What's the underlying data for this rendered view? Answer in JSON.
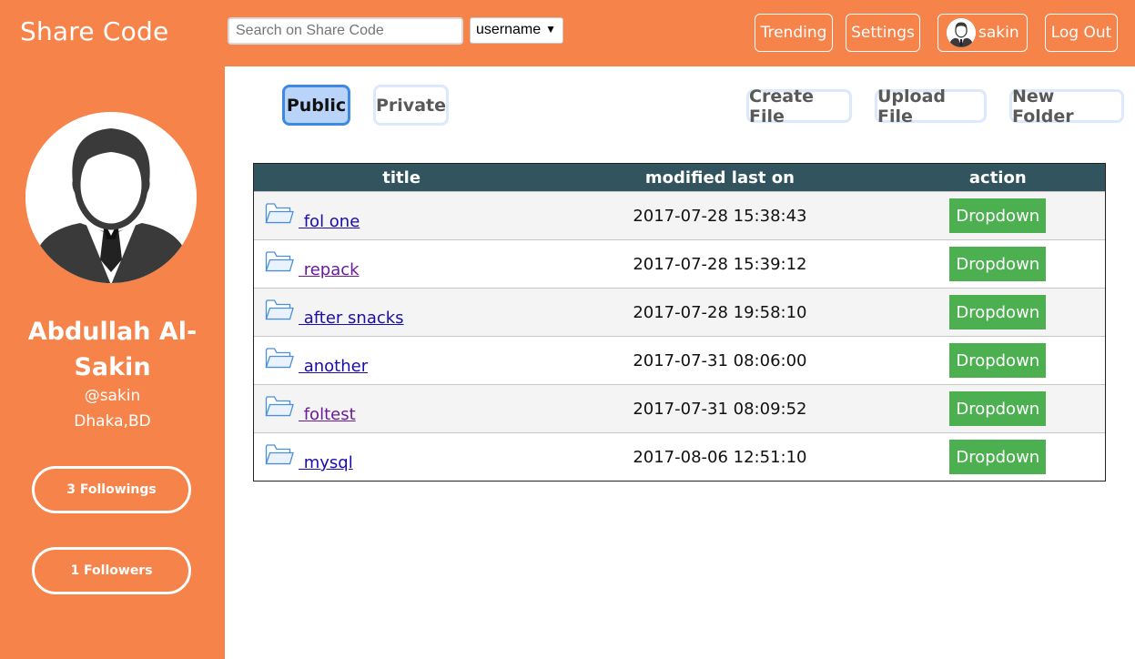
{
  "header": {
    "brand": "Share Code",
    "search_placeholder": "Search on Share Code",
    "search_type": "username",
    "nav": {
      "trending": "Trending",
      "settings": "Settings",
      "user": "sakin",
      "logout": "Log Out"
    }
  },
  "sidebar": {
    "name": "Abdullah Al-Sakin",
    "handle": "@sakin",
    "location": "Dhaka,BD",
    "followings": "3 Followings",
    "followers": "1 Followers"
  },
  "tabs": {
    "public": "Public",
    "private": "Private",
    "active": "Public"
  },
  "actions": {
    "create": "Create File",
    "upload": "Upload File",
    "new_folder": "New Folder"
  },
  "table": {
    "headers": [
      "title",
      "modified last on",
      "action"
    ],
    "rows": [
      {
        "title": " fol one",
        "modified": "2017-07-28 15:38:43",
        "action": "Dropdown",
        "visited": false
      },
      {
        "title": " repack",
        "modified": "2017-07-28 15:39:12",
        "action": "Dropdown",
        "visited": true
      },
      {
        "title": " after snacks",
        "modified": "2017-07-28 19:58:10",
        "action": "Dropdown",
        "visited": false
      },
      {
        "title": " another",
        "modified": "2017-07-31 08:06:00",
        "action": "Dropdown",
        "visited": false
      },
      {
        "title": " foltest",
        "modified": "2017-07-31 08:09:52",
        "action": "Dropdown",
        "visited": true
      },
      {
        "title": " mysql",
        "modified": "2017-08-06 12:51:10",
        "action": "Dropdown",
        "visited": false
      }
    ]
  },
  "colors": {
    "brand_orange": "#f6834a",
    "table_header": "#31545f",
    "dropdown_green": "#4caf50",
    "active_tab": "#b9d4f8",
    "link": "#1a0dab",
    "visited_link": "#6a1b9a"
  }
}
